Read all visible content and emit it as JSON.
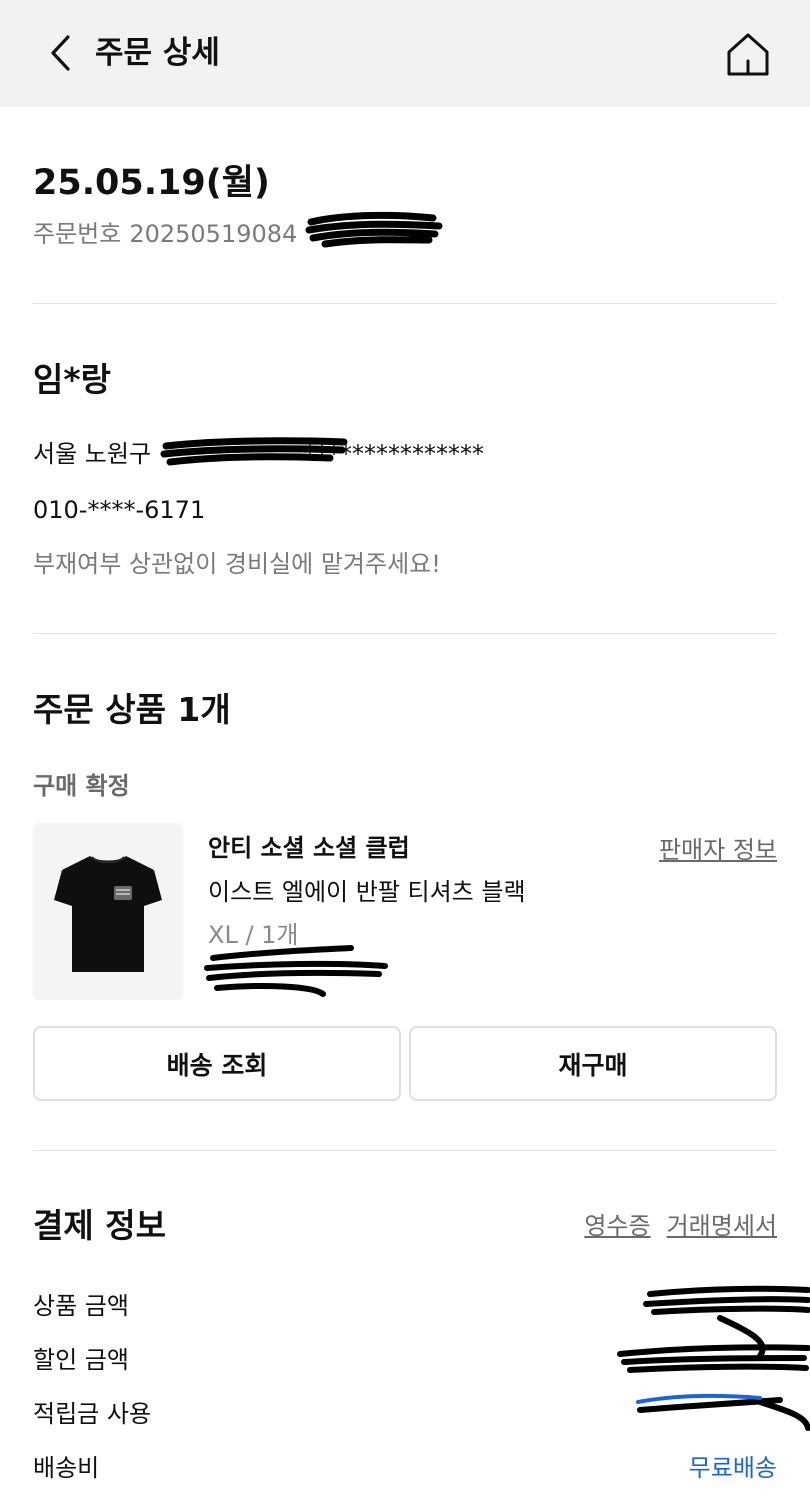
{
  "header": {
    "title": "주문 상세",
    "back_icon": "chevron-left-icon",
    "home_icon": "home-icon"
  },
  "order": {
    "date": "25.05.19(월)",
    "number_label": "주문번호",
    "number_visible": "20250519084"
  },
  "recipient": {
    "name": "임*랑",
    "address_prefix": "서울 노원구",
    "address_masked": "***************",
    "phone": "010-****-6171",
    "memo": "부재여부 상관없이 경비실에 맡겨주세요!"
  },
  "products": {
    "title": "주문 상품 1개",
    "status": "구매 확정",
    "item": {
      "brand": "안티 소셜 소셜 클럽",
      "name": "이스트 엘에이 반팔 티셔츠 블랙",
      "option": "XL / 1개",
      "seller_info_label": "판매자 정보"
    },
    "buttons": {
      "track_label": "배송 조회",
      "reorder_label": "재구매"
    }
  },
  "payment": {
    "title": "결제 정보",
    "receipt_label": "영수증",
    "statement_label": "거래명세서",
    "rows": [
      {
        "label": "상품 금액",
        "value": ""
      },
      {
        "label": "할인 금액",
        "value": ""
      },
      {
        "label": "적립금 사용",
        "value": ""
      },
      {
        "label": "배송비",
        "value": "무료배송"
      }
    ]
  },
  "colors": {
    "topbar_bg": "#f2f2f2",
    "accent_blue": "#1a66d9",
    "muted_text": "#7a7a7a",
    "divider": "#e4e4e4"
  }
}
